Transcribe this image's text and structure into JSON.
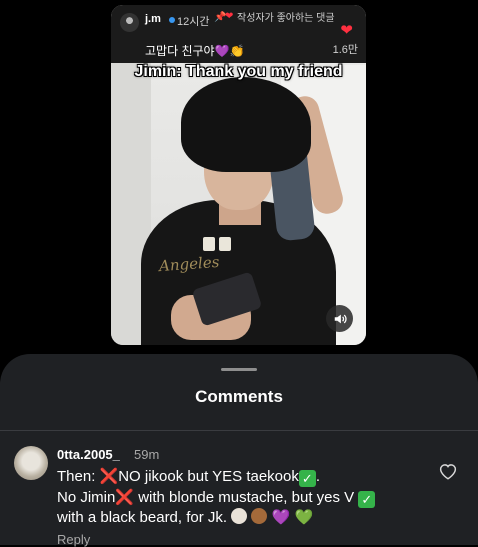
{
  "video": {
    "pinned_comment": {
      "username": "j.m",
      "time": "12시간",
      "pin_glyph": "📌",
      "liked_by_author": "작성자가 좋아하는 댓글",
      "text": "고맙다 친구야💜👏",
      "like_count": "1.6만"
    },
    "caption": "Jimin: Thank you my friend",
    "shirt_print": "Angeles"
  },
  "comments_sheet": {
    "title": "Comments",
    "comment": {
      "username": "0tta.2005_",
      "time": "59m",
      "line1_a": "Then: ",
      "line1_x": "❌",
      "line1_b": "NO jikook but YES taekook",
      "line1_check": "✓",
      "line1_end": ".",
      "line2_a": "No Jimin",
      "line2_x": "❌",
      "line2_b": " with blonde mustache, but yes V ",
      "line2_check": "✓",
      "line3_text": "with a black beard, for Jk.",
      "heart_purple": "💜",
      "heart_green": "💚",
      "reply_label": "Reply"
    }
  },
  "colors": {
    "sheet_bg": "#1f2124",
    "verified_blue": "#3897f0",
    "like_red": "#ff3040"
  },
  "icons": [
    "heart-icon",
    "sound-icon",
    "pin-icon",
    "like-heart-icon"
  ]
}
